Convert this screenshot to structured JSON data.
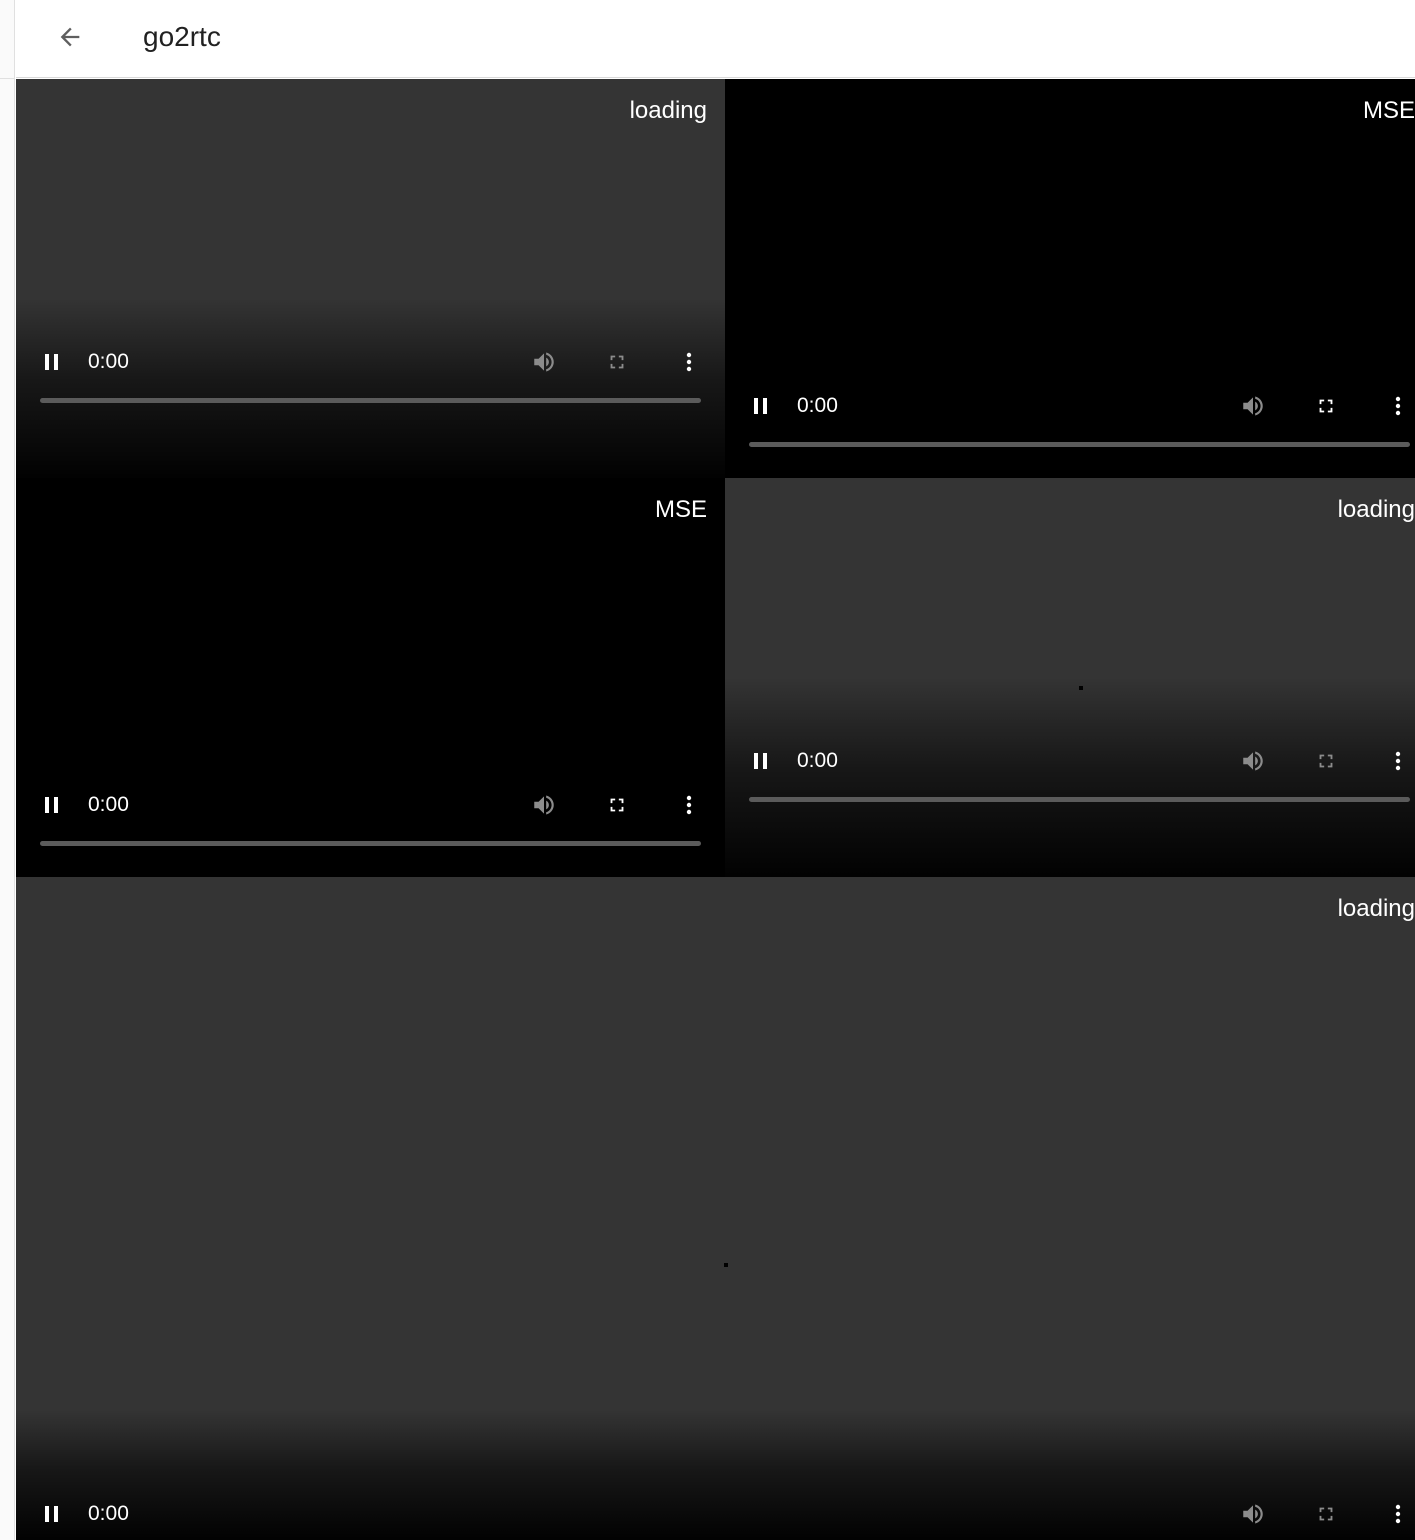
{
  "header": {
    "title": "go2rtc",
    "back_icon": "arrow-left-icon"
  },
  "tiles": [
    {
      "status": "loading",
      "time": "0:00",
      "progress": 0
    },
    {
      "status": "MSE",
      "time": "0:00",
      "progress": 0
    },
    {
      "status": "MSE",
      "time": "0:00",
      "progress": 0
    },
    {
      "status": "loading",
      "time": "0:00",
      "progress": 0
    },
    {
      "status": "loading",
      "time": "0:00",
      "progress": 0
    }
  ],
  "colors": {
    "loading_bg": "#343434",
    "mse_bg": "#000000",
    "text": "#ffffff"
  }
}
